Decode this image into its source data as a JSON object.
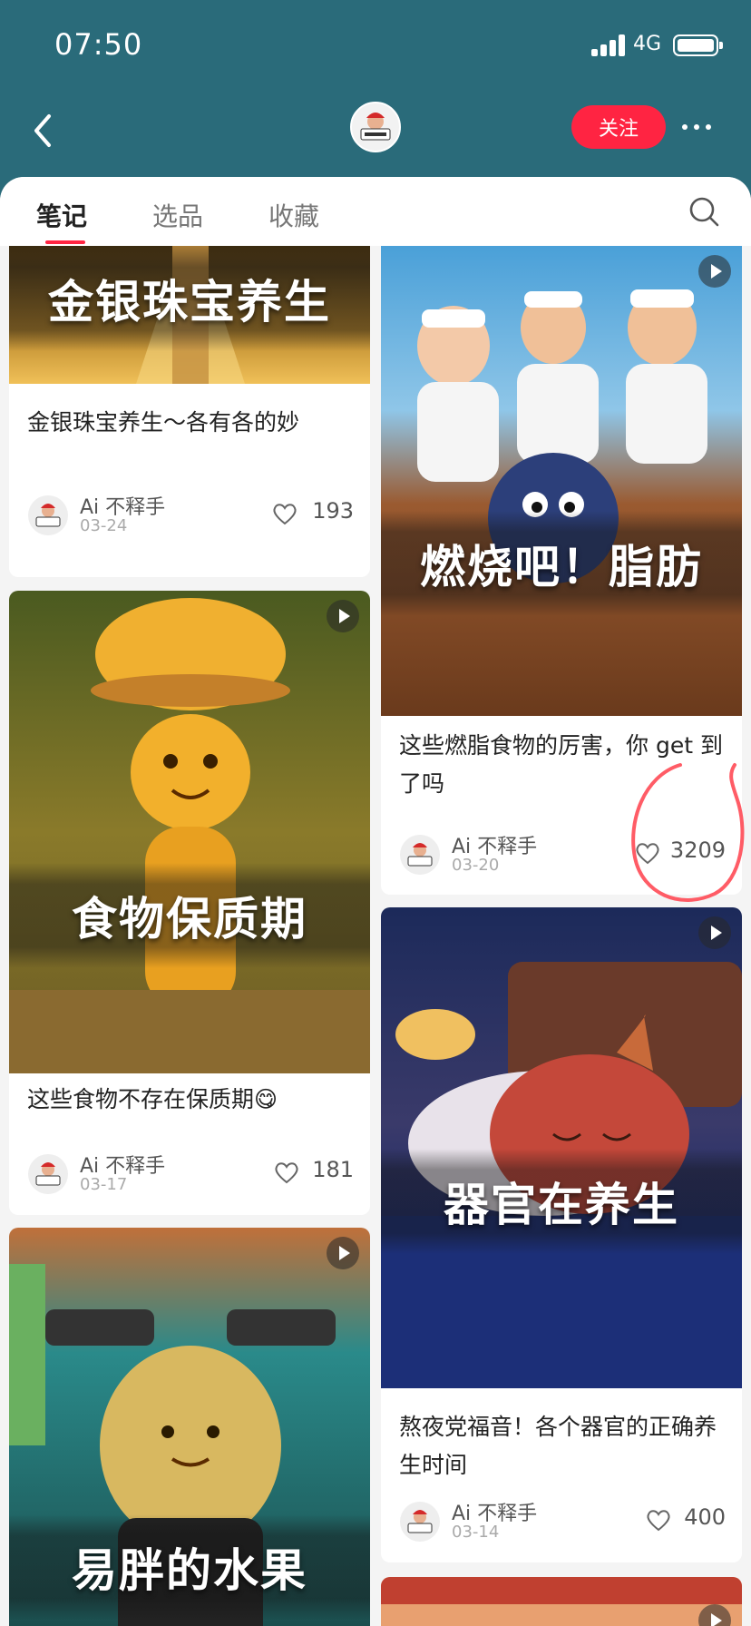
{
  "status_bar": {
    "time": "07:50",
    "network": "4G"
  },
  "nav": {
    "follow_label": "关注"
  },
  "tabs": [
    {
      "label": "笔记",
      "active": true
    },
    {
      "label": "选品",
      "active": false
    },
    {
      "label": "收藏",
      "active": false
    }
  ],
  "colors": {
    "brand": "#ff2442",
    "header_bg": "#2a6b7a"
  },
  "cards": [
    {
      "overlay_title": "金银珠宝养生",
      "title": "金银珠宝养生～各有各的妙",
      "author": "Ai 不释手",
      "date": "03-24",
      "likes": "193",
      "is_video": false
    },
    {
      "overlay_title": "燃烧吧！脂肪",
      "title": "这些燃脂食物的厉害，你 get 到了吗",
      "author": "Ai 不释手",
      "date": "03-20",
      "likes": "3209",
      "is_video": true
    },
    {
      "overlay_title": "食物保质期",
      "title": "这些食物不存在保质期😋",
      "author": "Ai 不释手",
      "date": "03-17",
      "likes": "181",
      "is_video": true
    },
    {
      "overlay_title": "器官在养生",
      "title": "熬夜党福音！各个器官的正确养生时间",
      "author": "Ai 不释手",
      "date": "03-14",
      "likes": "400",
      "is_video": true
    },
    {
      "overlay_title": "易胖的水果",
      "is_video": true
    },
    {
      "overlay_title": "",
      "is_video": true
    }
  ]
}
